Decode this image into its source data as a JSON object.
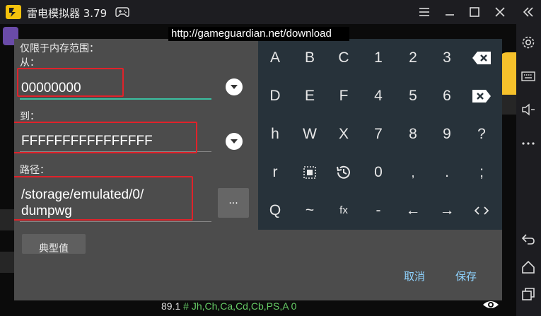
{
  "window": {
    "title": "雷电模拟器 3.79"
  },
  "overlay_url": "http://gameguardian.net/download",
  "dialog": {
    "range_label": "仅限于内存范围：",
    "from_label": "从：",
    "from_value": "00000000",
    "to_label": "到：",
    "to_value": "FFFFFFFFFFFFFFFF",
    "path_label": "路径：",
    "path_line1": "/storage/emulated/0/",
    "path_line2": "dumpwg",
    "browse_label": "...",
    "typical_label": "典型值",
    "cancel_label": "取消",
    "save_label": "保存"
  },
  "keyboard": {
    "rows": [
      [
        "A",
        "B",
        "C",
        "1",
        "2",
        "3",
        "⌫"
      ],
      [
        "D",
        "E",
        "F",
        "4",
        "5",
        "6",
        "⌦"
      ],
      [
        "h",
        "W",
        "X",
        "7",
        "8",
        "9",
        "?"
      ],
      [
        "r",
        "select-icon",
        "history-icon",
        "0",
        "",
        ".",
        ";"
      ],
      [
        "Q",
        "~",
        "fx",
        "-",
        "←",
        "→",
        "↹"
      ]
    ]
  },
  "background": {
    "status_line_number": "89.1",
    "status_line_text": "# Jh,Ch,Ca,Cd,Cb,PS,A 0"
  },
  "colors": {
    "accent": "#3bbfa0",
    "highlight_box": "#e0222a",
    "dialog_bg": "#4c4c4c",
    "keyboard_bg": "#27323a",
    "action_text": "#8fd3ff"
  }
}
